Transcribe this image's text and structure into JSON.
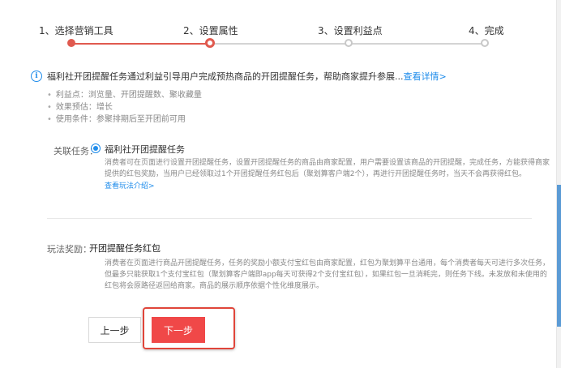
{
  "steps": [
    {
      "label": "1、选择营销工具",
      "state": "done"
    },
    {
      "label": "2、设置属性",
      "state": "current"
    },
    {
      "label": "3、设置利益点",
      "state": "todo"
    },
    {
      "label": "4、完成",
      "state": "todo"
    }
  ],
  "colors": {
    "accent": "#e05a4f",
    "primary_button": "#f04848",
    "link": "#1f8ceb",
    "inactive": "#c8c8c8"
  },
  "info": {
    "icon": "info-icon",
    "text": "福利社开团提醒任务通过利益引导用户完成预热商品的开团提醒任务，帮助商家提升参展...",
    "link": "查看详情>"
  },
  "bullets": [
    "利益点：浏览量、开团提醒数、聚收藏量",
    "效果预估：增长",
    "使用条件：参聚排期后至开团前可用"
  ],
  "related_task": {
    "label": "关联任务：",
    "option": "福利社开团提醒任务",
    "selected": true,
    "desc_lines": [
      "消费者可在页面进行设置开团提醒任务，设置开团提醒任务的商品由商家配置，用户需要设置该商品的开团提醒，完成任务，方能获得商家",
      "提供的红包奖励，当用户已经领取过1个开团提醒任务红包后（聚划算客户端2个），再进行开团提醒任务时，当天不会再获得红包。"
    ],
    "link": "查看玩法介绍>"
  },
  "reward": {
    "label": "玩法奖励：",
    "title": "开团提醒任务红包",
    "desc_lines": [
      "消费者在页面进行商品开团提醒任务，任务的奖励小额支付宝红包由商家配置，红包为聚划算平台通用，每个消费者每天可进行多次任务，",
      "但最多只能获取1个支付宝红包（聚划算客户端即app每天可获得2个支付宝红包），如果红包一旦消耗完，则任务下线。未发放和未使用的",
      "红包将会原路径返回给商家。商品的展示顺序依据个性化维度展示。"
    ]
  },
  "buttons": {
    "prev": "上一步",
    "next": "下一步"
  }
}
